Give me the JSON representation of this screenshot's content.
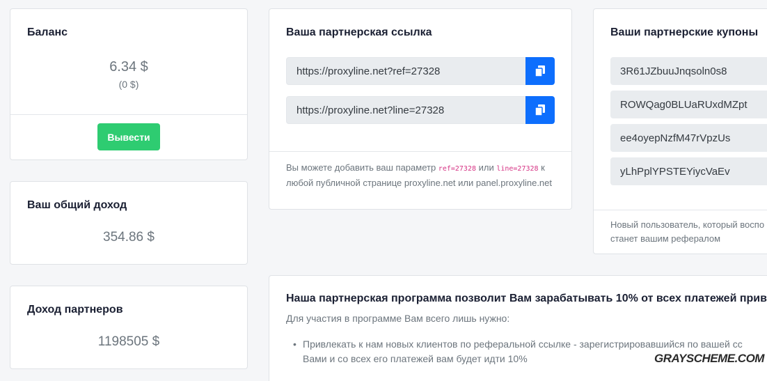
{
  "balance": {
    "title": "Баланс",
    "amount": "6.34 $",
    "pending": "(0 $)",
    "withdraw_label": "Вывести"
  },
  "total_income": {
    "title": "Ваш общий доход",
    "amount": "354.86 $"
  },
  "partner_income": {
    "title": "Доход партнеров",
    "amount": "1198505 $"
  },
  "partner_link": {
    "title": "Ваша партнерская ссылка",
    "links": [
      "https://proxyline.net?ref=27328",
      "https://proxyline.net?line=27328"
    ],
    "note_prefix": "Вы можете добавить ваш параметр ",
    "param_ref": "ref=27328",
    "note_or": " или ",
    "param_line": "line=27328",
    "note_suffix": " к любой публичной странице proxyline.net или panel.proxyline.net"
  },
  "coupons": {
    "title": "Ваши партнерские купоны",
    "items": [
      "3R61JZbuuJnqsoln0s8",
      "ROWQag0BLUaRUxdMZpt",
      "ee4oyepNzfM47rVpzUs",
      "yLhPplYPSTEYiycVaEv"
    ],
    "note_line1": "Новый пользователь, который воспо",
    "note_line2": "станет вашим рефералом"
  },
  "program": {
    "title": "Наша партнерская программа позволит Вам зарабатывать 10% от всех платежей прив",
    "intro": "Для участия в программе Вам всего лишь нужно:",
    "bullet_line1": "Привлекать к нам новых клиентов по реферальной ссылке - зарегистрировавшийся по вашей сс",
    "bullet_line2": "Вами и со всех его платежей вам будет идти 10%"
  },
  "watermark": "GRAYSCHEME.COM",
  "colors": {
    "withdraw": "#2ecc71",
    "copy": "#0d6efd",
    "code": "#d63384"
  }
}
